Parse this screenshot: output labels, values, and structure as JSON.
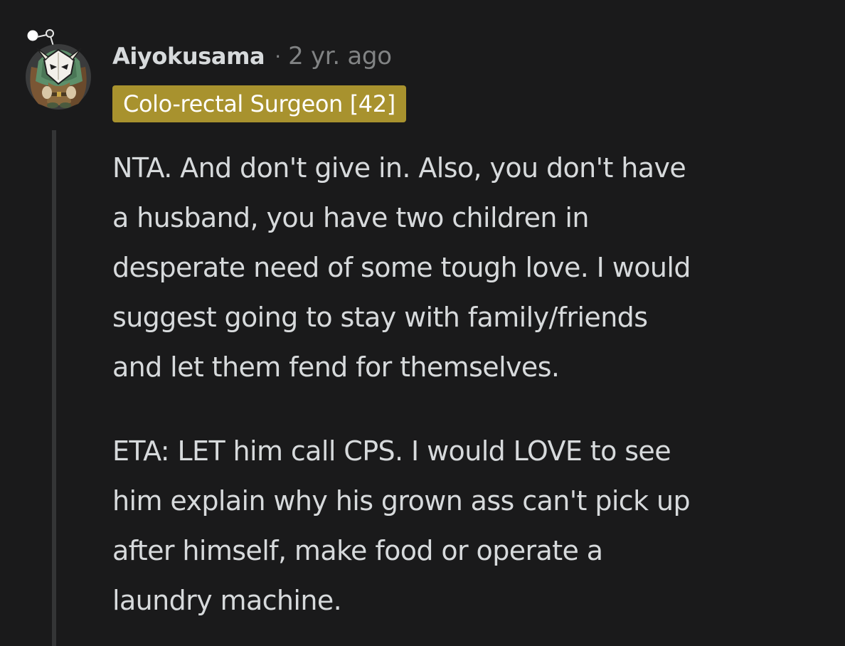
{
  "comment": {
    "username": "Aiyokusama",
    "separator": "·",
    "timestamp": "2 yr. ago",
    "flair": {
      "text": "Colo-rectal Surgeon [42]",
      "color": "#a8922e"
    },
    "avatar": {
      "icon": "snoo-avatar-masked-character-icon"
    },
    "paragraphs": [
      {
        "lines": [
          "NTA. And don't give in. Also, you don't have",
          "a husband, you have two children in",
          "desperate need of some tough love. I would",
          "suggest going to stay with family/friends",
          "and let them fend for themselves."
        ]
      },
      {
        "lines": [
          "ETA: LET him call CPS. I would LOVE to see",
          "him explain why his grown ass can't pick up",
          "after himself, make food or operate a",
          "laundry machine."
        ]
      }
    ]
  },
  "theme": {
    "background": "#1a1a1b",
    "text": "#d7dadc",
    "muted": "#818384",
    "thread_line": "#343536"
  }
}
